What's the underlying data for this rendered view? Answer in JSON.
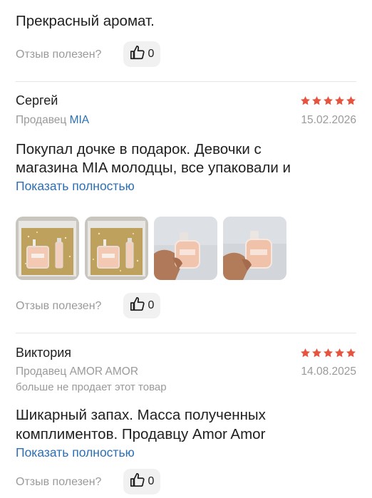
{
  "top_review": {
    "text": "Прекрасный аромат.",
    "helpful_label": "Отзыв полезен?",
    "likes": "0"
  },
  "review1": {
    "author": "Сергей",
    "seller_prefix": "Продавец",
    "seller_name": "MIA",
    "date": "15.02.2026",
    "rating": 5,
    "text_line1": "Покупал дочке в подарок. Девочки с",
    "text_line2": "магазина MIA молодцы, все упаковали и",
    "show_more": "Показать полностью",
    "photo_count": 4,
    "helpful_label": "Отзыв полезен?",
    "likes": "0"
  },
  "review2": {
    "author": "Виктория",
    "seller_prefix": "Продавец",
    "seller_name": "AMOR AMOR",
    "seller_note": "больше не продает этот товар",
    "date": "14.08.2025",
    "rating": 5,
    "text_line1": "Шикарный запах. Масса полученных",
    "text_line2": "комплиментов. Продавцу Amor Amor",
    "show_more": "Показать полностью",
    "helpful_label": "Отзыв полезен?",
    "likes": "0"
  },
  "colors": {
    "star": "#e8533f",
    "link": "#2b6fb7",
    "muted": "#9a9a9a"
  }
}
